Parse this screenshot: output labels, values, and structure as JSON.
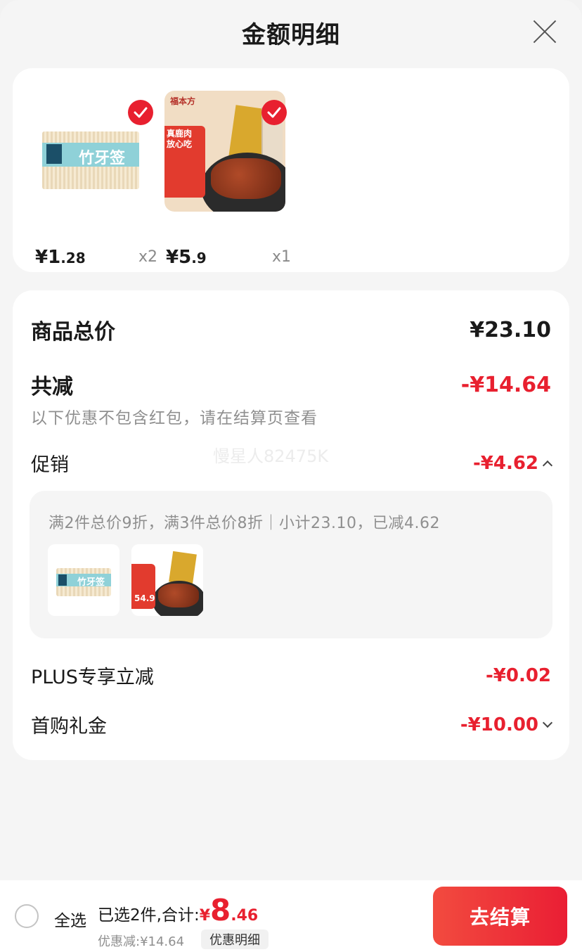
{
  "header": {
    "title": "金额明细"
  },
  "products": [
    {
      "price_main": "¥1",
      "price_dec": ".28",
      "qty": "x2",
      "thumb_text": "竹牙签",
      "thumb_tag": "15g"
    },
    {
      "price_main": "¥5",
      "price_dec": ".9",
      "qty": "x1",
      "brand": "福本方",
      "badge_lines": [
        "真鹿肉",
        "放心吃"
      ],
      "thumb_price": "54.9"
    }
  ],
  "detail": {
    "total_label": "商品总价",
    "total_value": "¥23.10",
    "reduce_label": "共减",
    "reduce_value": "-¥14.64",
    "note": "以下优惠不包含红包，请在结算页查看",
    "watermark": "慢星人82475K",
    "promo_label": "促销",
    "promo_value": "-¥4.62",
    "promo_desc": "满2件总价9折，满3件总价8折｜小计23.10，已减4.62",
    "plus_label": "PLUS专享立减",
    "plus_value": "-¥0.02",
    "gift_label": "首购礼金",
    "gift_value": "-¥10.00"
  },
  "bottom": {
    "select_all": "全选",
    "selected_text": "已选2件,合计:",
    "currency": "¥",
    "total_int": "8",
    "total_dec": ".46",
    "saved": "优惠减:¥14.64",
    "detail_tag": "优惠明细",
    "checkout": "去结算"
  },
  "colors": {
    "accent": "#e8202f",
    "button": "#ea1e34"
  }
}
